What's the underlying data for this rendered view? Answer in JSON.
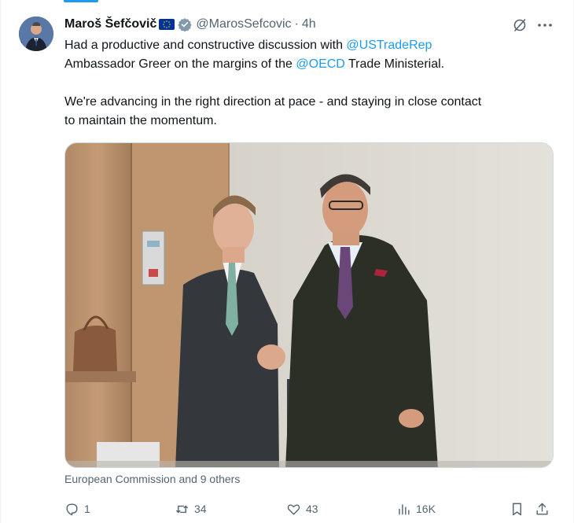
{
  "author": {
    "name": "Maroš Šefčovič",
    "handle": "@MarosSefcovic",
    "separator": "·",
    "time": "4h"
  },
  "text": {
    "line1_start": "Had a productive and constructive discussion with ",
    "mention1": "@USTradeRep",
    "line2_start": "Ambassador Greer on the margins of the ",
    "mention2": "@OECD",
    "line2_end": " Trade Ministerial.",
    "line3": "We're advancing in the right direction at pace - and staying in close contact",
    "line4": "to maintain the momentum."
  },
  "tagged": "European Commission and 9 others",
  "actions": {
    "replies": "1",
    "reposts": "34",
    "likes": "43",
    "views": "16K"
  },
  "colors": {
    "accent": "#1d9bf0",
    "muted": "#536471",
    "text": "#0f1419",
    "eu_blue": "#003399",
    "eu_gold": "#ffcc00"
  },
  "icons": {
    "verified": "verified-badge-icon",
    "flag": "eu-flag-icon",
    "grok": "grok-icon",
    "more": "more-icon",
    "reply": "reply-icon",
    "repost": "repost-icon",
    "like": "heart-icon",
    "views": "views-icon",
    "bookmark": "bookmark-icon",
    "share": "share-icon"
  }
}
